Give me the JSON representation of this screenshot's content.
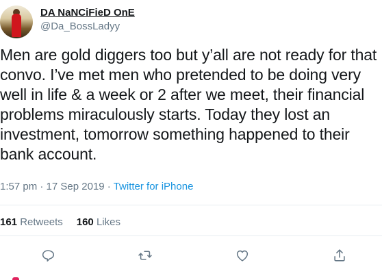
{
  "user": {
    "display_name": "DA NaNCiFieD OnE",
    "handle": "@Da_BossLadyy"
  },
  "tweet": {
    "text": "Men are gold diggers too but y’all are not ready for that convo. I’ve met men who pretended to be doing very well in life & a week or 2 after we meet, their financial problems miraculously starts. Today they lost an investment, tomorrow something happened to their bank account."
  },
  "meta": {
    "time": "1:57 pm",
    "separator": " · ",
    "date": "17 Sep 2019",
    "source": "Twitter for iPhone"
  },
  "stats": {
    "retweets_count": "161",
    "retweets_label": "Retweets",
    "likes_count": "160",
    "likes_label": "Likes"
  },
  "actions": [
    {
      "icon": "reply-icon"
    },
    {
      "icon": "retweet-icon"
    },
    {
      "icon": "like-icon"
    },
    {
      "icon": "share-icon"
    }
  ],
  "colors": {
    "text": "#14171a",
    "secondary": "#657786",
    "link": "#1b95e0",
    "divider": "#e6ecf0"
  }
}
